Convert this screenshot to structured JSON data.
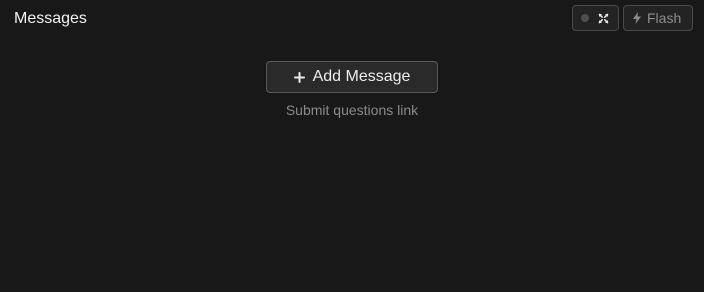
{
  "panel": {
    "title": "Messages"
  },
  "controls": {
    "mode_toggle_icons": [
      "status-dot-icon",
      "expand-icon"
    ],
    "flash_label": "Flash",
    "flash_icon": "lightning-bolt-icon"
  },
  "main": {
    "add_button_label": "Add Message",
    "add_button_icon": "plus-icon",
    "submit_link_label": "Submit questions link"
  },
  "colors": {
    "background": "#181818",
    "button_border": "#5a5a5a",
    "muted_text": "#8a8a8a"
  }
}
